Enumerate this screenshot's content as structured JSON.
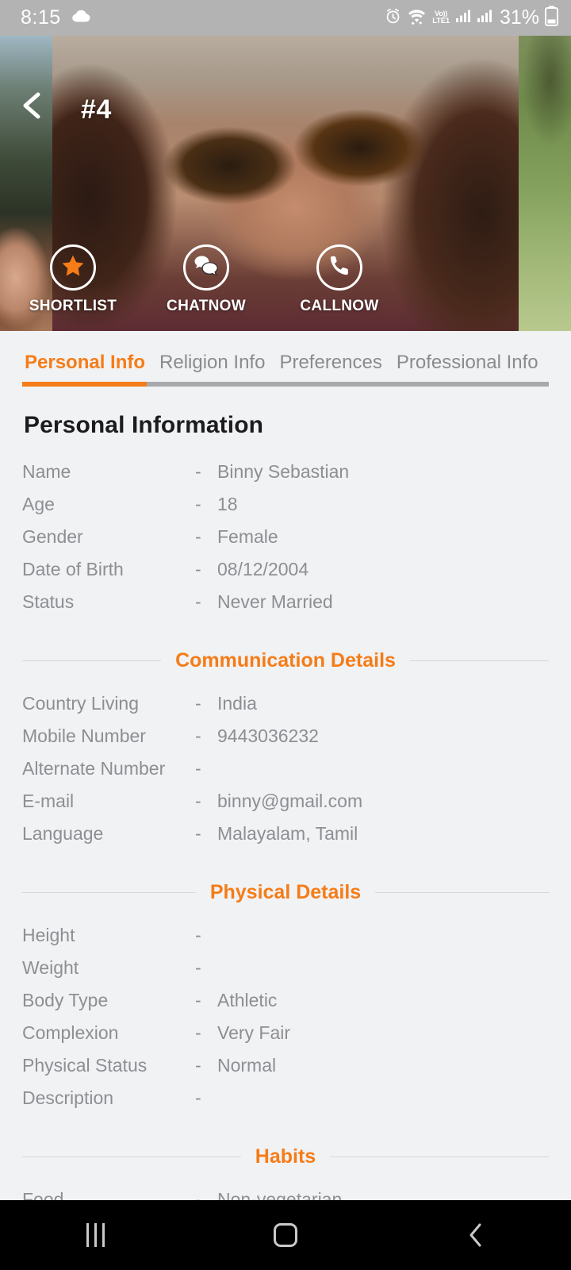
{
  "status_bar": {
    "time": "8:15",
    "cloud_icon": "cloud-icon",
    "alarm_icon": "alarm-icon",
    "wifi_icon": "wifi-icon",
    "volte_top": "Vo))",
    "volte_bottom": "LTE1",
    "signal_icon_1": "signal-bars-icon",
    "signal_icon_2": "signal-bars-icon",
    "battery_percent": "31%",
    "battery_icon": "battery-icon"
  },
  "header": {
    "back_icon": "back-chevron-icon",
    "photo_index_label": "#4",
    "actions": [
      {
        "label": "SHORTLIST",
        "icon": "star-icon"
      },
      {
        "label": "CHATNOW",
        "icon": "chat-bubbles-icon"
      },
      {
        "label": "CALLNOW",
        "icon": "phone-icon"
      }
    ]
  },
  "tabs": [
    {
      "label": "Personal Info",
      "active": true
    },
    {
      "label": "Religion Info",
      "active": false
    },
    {
      "label": "Preferences",
      "active": false
    },
    {
      "label": "Professional Info",
      "active": false
    }
  ],
  "main": {
    "page_title": "Personal Information",
    "personal": [
      {
        "label": "Name",
        "dash": "-",
        "value": "Binny Sebastian"
      },
      {
        "label": "Age",
        "dash": "-",
        "value": "18"
      },
      {
        "label": "Gender",
        "dash": "-",
        "value": "Female"
      },
      {
        "label": "Date of Birth",
        "dash": "-",
        "value": "08/12/2004"
      },
      {
        "label": "Status",
        "dash": "-",
        "value": "Never Married"
      }
    ],
    "communication_heading": "Communication Details",
    "communication": [
      {
        "label": "Country Living",
        "dash": "-",
        "value": "India"
      },
      {
        "label": "Mobile Number",
        "dash": "-",
        "value": "9443036232"
      },
      {
        "label": "Alternate Number",
        "dash": "-",
        "value": ""
      },
      {
        "label": "E-mail",
        "dash": "-",
        "value": "binny@gmail.com"
      },
      {
        "label": "Language",
        "dash": "-",
        "value": "Malayalam, Tamil"
      }
    ],
    "physical_heading": "Physical Details",
    "physical": [
      {
        "label": "Height",
        "dash": "-",
        "value": ""
      },
      {
        "label": "Weight",
        "dash": "-",
        "value": ""
      },
      {
        "label": "Body Type",
        "dash": "-",
        "value": "Athletic"
      },
      {
        "label": "Complexion",
        "dash": "-",
        "value": "Very Fair"
      },
      {
        "label": "Physical Status",
        "dash": "-",
        "value": "Normal"
      },
      {
        "label": "Description",
        "dash": "-",
        "value": ""
      }
    ],
    "habits_heading": "Habits",
    "habits": [
      {
        "label": "Food",
        "dash": "-",
        "value": "Non-vegetarian"
      }
    ]
  },
  "nav_bar": {
    "recents_icon": "recents-icon",
    "home_icon": "home-icon",
    "back_icon": "back-icon"
  },
  "colors": {
    "accent": "#f57c17",
    "page_bg": "#f1f2f4",
    "text_muted": "#8e8e93",
    "text_dark": "#1c1c1e",
    "status_bar_bg": "#b3b3b3"
  }
}
